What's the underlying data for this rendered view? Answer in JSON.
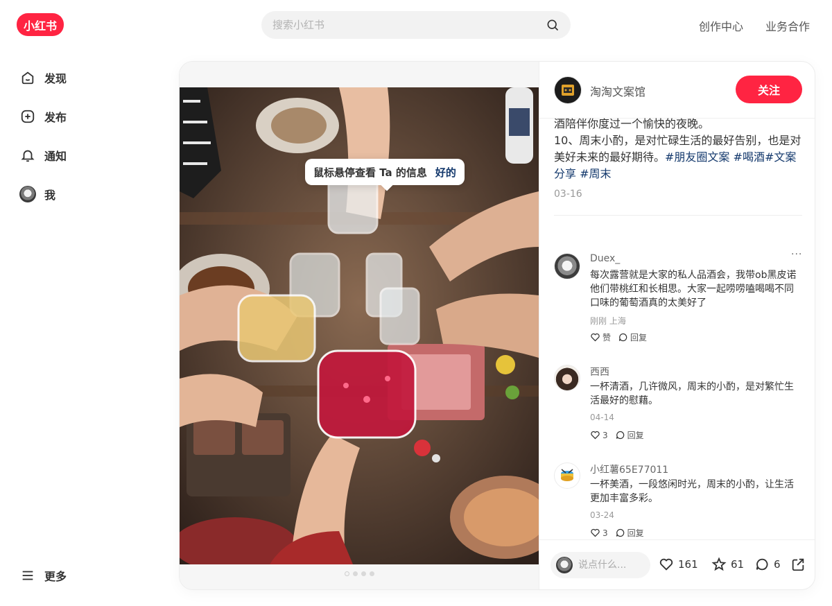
{
  "header": {
    "logo_text": "小红书",
    "search_placeholder": "搜索小红书",
    "links": [
      "创作中心",
      "业务合作"
    ]
  },
  "sidebar": {
    "items": [
      {
        "label": "发现",
        "icon": "home-icon"
      },
      {
        "label": "发布",
        "icon": "plus-square-icon"
      },
      {
        "label": "通知",
        "icon": "bell-icon"
      },
      {
        "label": "我",
        "icon": "avatar"
      }
    ],
    "more_label": "更多"
  },
  "note": {
    "author": "淘淘文案馆",
    "follow_label": "关注",
    "body_line1": "酒陪伴你度过一个愉快的夜晚。",
    "body_line2": "10、周末小酌，是对忙碌生活的最好告别，也是对美好未来的最好期待。",
    "tags": [
      "#朋友圈文案",
      "#喝酒",
      "#文案分享",
      "#周末"
    ],
    "date": "03-16",
    "image_count": 4,
    "image_active": 1
  },
  "tooltip": {
    "text": "鼠标悬停查看 Ta 的信息",
    "ok_label": "好的"
  },
  "comments": [
    {
      "name": "Duex_",
      "text": "每次露营就是大家的私人品酒会，我带ob黑皮诺他们带桃红和长相思。大家一起唠唠嗑喝喝不同口味的葡萄酒真的太美好了",
      "meta": "刚刚 上海",
      "likes": "赞",
      "reply": "回复",
      "more": "···"
    },
    {
      "name": "西西",
      "text": "一杯清酒，几许微风，周末的小酌，是对繁忙生活最好的慰藉。",
      "meta": "04-14",
      "likes": "3",
      "reply": "回复"
    },
    {
      "name": "小红薯65E77011",
      "text": "一杯美酒，一段悠闲时光，周末的小酌，让生活更加丰富多彩。",
      "meta": "03-24",
      "likes": "3",
      "reply": "回复"
    }
  ],
  "footer": {
    "input_placeholder": "说点什么...",
    "like_count": "161",
    "collect_count": "61",
    "comment_count": "6"
  },
  "colors": {
    "brand": "#ff2442",
    "tag": "#13386c"
  }
}
